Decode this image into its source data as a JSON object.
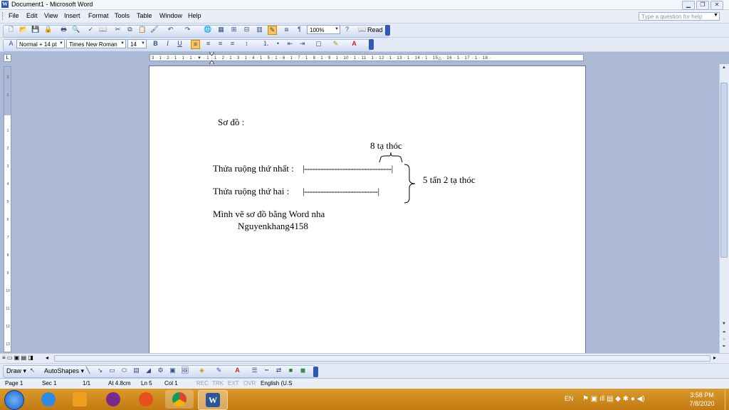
{
  "window": {
    "title": "Document1 - Microsoft Word"
  },
  "menu": [
    "File",
    "Edit",
    "View",
    "Insert",
    "Format",
    "Tools",
    "Table",
    "Window",
    "Help"
  ],
  "help_placeholder": "Type a question for help",
  "standard_toolbar": {
    "zoom": "100%",
    "read_label": "Read"
  },
  "formatting_toolbar": {
    "style": "Normal + 14 pt",
    "font": "Times New Roman",
    "size": "14"
  },
  "ruler": {
    "ticks": "3 · 1 · 2 · 1 · 1 · 1 · ▼ · 1 · 1 · 2 · 1 · 3 · 1 · 4 · 1 · 5 · 1 · 6 · 1 · 7 · 1 · 8 · 1 · 9 · 1 · 10 · 1 · 11 · 1 · 12 · 1 · 13 · 1 · 14 · 1 · 15△ · 16 · 1 · 17 · 1 · 18 ·"
  },
  "document": {
    "heading": "Sơ đồ :",
    "diff_label": "8 tạ thóc",
    "field1_label": "Thửa ruộng thứ nhất :",
    "field1_bar": "|--------------------------------|",
    "field2_label": "Thửa ruộng thứ hai :",
    "field2_bar": "|---------------------------|",
    "total_label": "5 tấn 2 tạ thóc",
    "note": "Mình vẽ sơ đồ bằng Word nha",
    "author": "Nguyenkhang4158"
  },
  "drawing_toolbar": {
    "draw": "Draw",
    "autoshapes": "AutoShapes"
  },
  "status": {
    "page": "Page 1",
    "sec": "Sec 1",
    "pages": "1/1",
    "at": "At 4.8cm",
    "ln": "Ln 5",
    "col": "Col 1",
    "rec": "REC",
    "trk": "TRK",
    "ext": "EXT",
    "ovr": "OVR",
    "lang": "English (U.S"
  },
  "taskbar": {
    "lang": "EN",
    "time": "3:58 PM",
    "date": "7/8/2020"
  }
}
